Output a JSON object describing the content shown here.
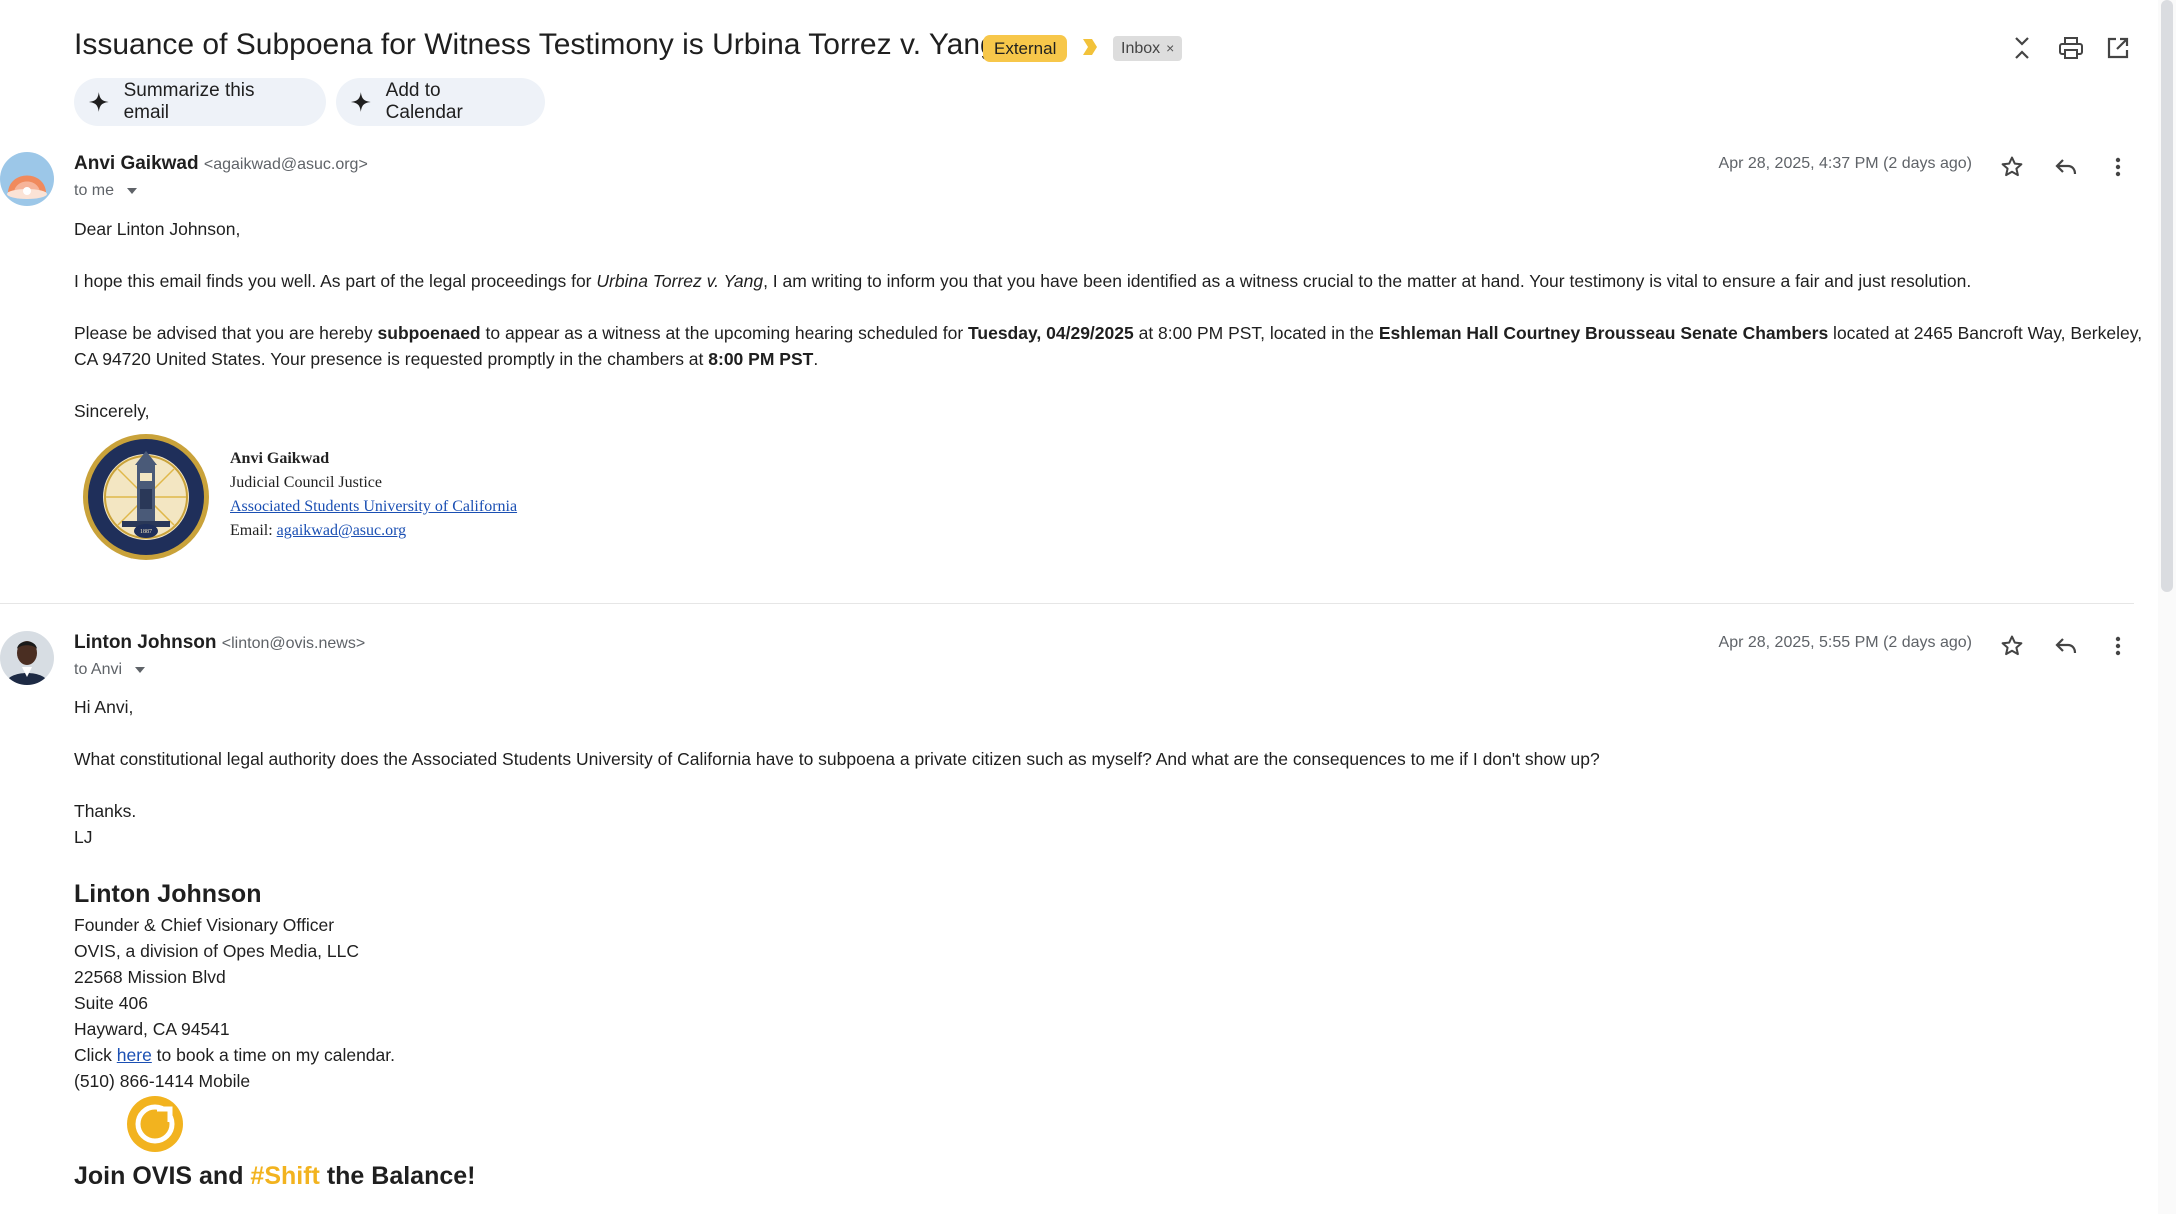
{
  "header": {
    "subject": "Issuance of Subpoena for Witness Testimony is Urbina Torrez v. Yang",
    "external_label": "External",
    "inbox_label": "Inbox",
    "inbox_remove": "×",
    "summarize_label": "Summarize this email",
    "calendar_label": "Add to Calendar"
  },
  "message1": {
    "sender_name": "Anvi Gaikwad",
    "sender_email": "<agaikwad@asuc.org>",
    "to": "to me",
    "date": "Apr 28, 2025, 4:37 PM (2 days ago)",
    "greeting": "Dear Linton Johnson,",
    "p1_a": "I hope this email finds you well. As part of the legal proceedings for ",
    "p1_case": "Urbina Torrez v. Yang",
    "p1_b": ", I am writing to inform you that you have been identified as a witness crucial to the matter at hand. Your testimony is vital to ensure a fair and just resolution.",
    "p2_a": "Please be advised that you are hereby ",
    "p2_subpoenaed": "subpoenaed",
    "p2_b": " to appear as a witness at the upcoming hearing scheduled for ",
    "p2_date": "Tuesday, 04/29/2025",
    "p2_c": " at 8:00 PM PST, located in the ",
    "p2_place": "Eshleman Hall Courtney Brousseau Senate Chambers",
    "p2_d": " located at 2465 Bancroft Way, Berkeley,",
    "p2_line2_a": "CA 94720 United States. Your presence is requested promptly in the chambers at ",
    "p2_time": "8:00 PM PST",
    "p2_end": ".",
    "closing": "Sincerely,",
    "sig_name": "Anvi Gaikwad",
    "sig_title": "Judicial Council Justice",
    "sig_org": "Associated Students University of  California",
    "sig_email_label": "Email: ",
    "sig_email": "agaikwad@asuc.org",
    "seal_text": "SINCE 1887"
  },
  "message2": {
    "sender_name": "Linton Johnson",
    "sender_email": "<linton@ovis.news>",
    "to": "to Anvi",
    "date": "Apr 28, 2025, 5:55 PM (2 days ago)",
    "greeting": "Hi Anvi,",
    "question": "What constitutional legal authority does the Associated Students University of California have to subpoena a private citizen such as myself?  And what are the consequences to me if I don't show up?",
    "thanks": "Thanks.",
    "initials": "LJ",
    "sig_name": "Linton Johnson",
    "sig_title": "Founder & Chief Visionary Officer",
    "sig_company": "OVIS, a division of Opes Media, LLC",
    "sig_addr1": "22568 Mission Blvd",
    "sig_addr2": "Suite 406",
    "sig_addr3": "Hayward, CA 94541",
    "sig_click": "Click ",
    "sig_here": "here",
    "sig_click_rest": " to book a time on my calendar.",
    "sig_phone": "(510) 866-1414 Mobile",
    "join_a": "Join OVIS and  ",
    "join_hash": "#Shift",
    "join_b": " the Balance!"
  },
  "colors": {
    "external_badge": "#f7c74a",
    "importance_marker": "#f2c23a",
    "link": "#1a4fb3",
    "ovis_gold": "#f2b31f"
  },
  "icons": [
    "expand-collapse-icon",
    "print-icon",
    "open-in-new-window-icon",
    "sparkle-icon",
    "star-icon",
    "reply-icon",
    "more-vert-icon",
    "dropdown-arrow-icon"
  ]
}
